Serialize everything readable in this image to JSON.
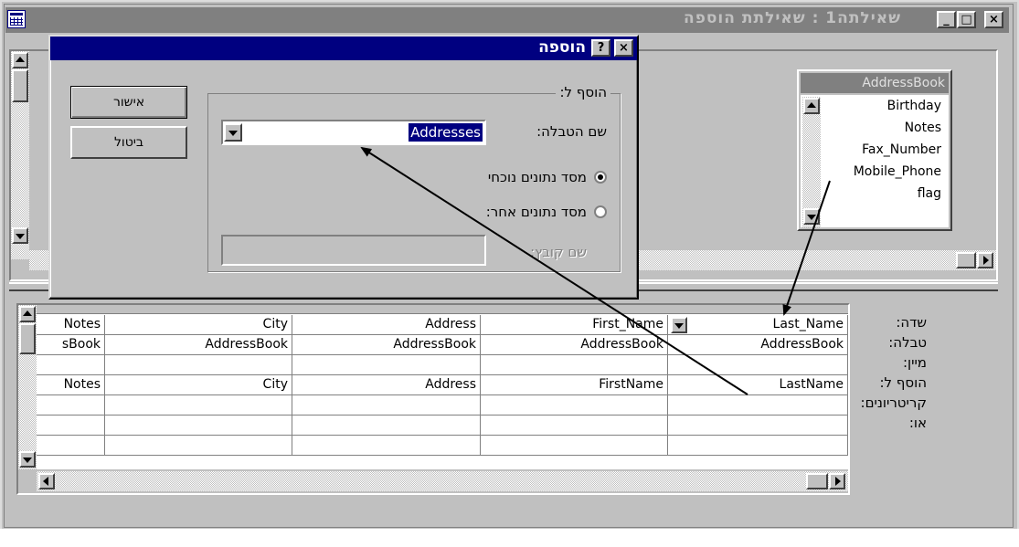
{
  "window": {
    "title": "שאילתה1 : שאילתת הוספה",
    "close_glyph": "×",
    "max_glyph": "□",
    "min_glyph": "_"
  },
  "table_box": {
    "name": "AddressBook",
    "fields": [
      "Birthday",
      "Notes",
      "Fax_Number",
      "Mobile_Phone",
      "flag"
    ]
  },
  "dialog": {
    "title": "הוספה",
    "help_glyph": "?",
    "close_glyph": "×",
    "group_label": "הוסף ל:",
    "table_name_label": "שם הטבלה:",
    "table_name_value": "Addresses",
    "radio_current_db": "מסד נתונים נוכחי",
    "radio_other_db": "מסד נתונים אחר:",
    "file_name_label": "שם קובץ:",
    "file_name_value": "",
    "ok_label": "אישור",
    "cancel_label": "ביטול",
    "current_db_selected": true
  },
  "grid": {
    "row_labels": [
      "שדה:",
      "טבלה:",
      "מיין:",
      "הוסף ל:",
      "קריטריונים:",
      "או:"
    ],
    "columns": [
      {
        "field": "Last_Name",
        "table": "AddressBook",
        "sort": "",
        "append_to": "LastName"
      },
      {
        "field": "First_Name",
        "table": "AddressBook",
        "sort": "",
        "append_to": "FirstName"
      },
      {
        "field": "Address",
        "table": "AddressBook",
        "sort": "",
        "append_to": "Address"
      },
      {
        "field": "City",
        "table": "AddressBook",
        "sort": "",
        "append_to": "City"
      },
      {
        "field": "Notes",
        "table": "sBook",
        "sort": "",
        "append_to": "Notes"
      }
    ]
  }
}
